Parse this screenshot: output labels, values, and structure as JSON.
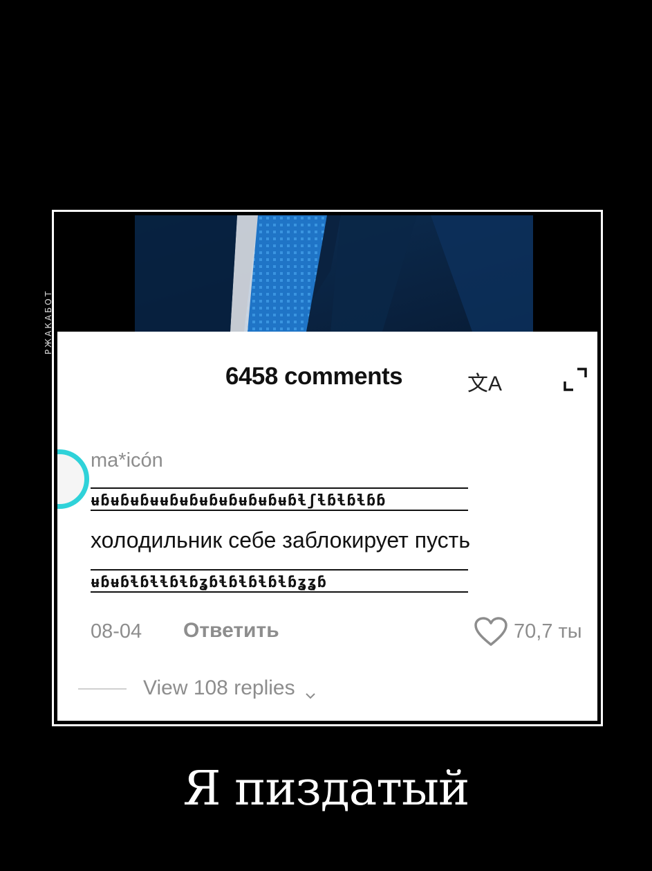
{
  "watermark": {
    "text": "РЖАКАБОТ"
  },
  "comments": {
    "count_label": "6458 comments",
    "translate_icon_label": "文A",
    "comment": {
      "username": "ma*icón",
      "deco_top": "ʉɓʉɓʉɓʉʉɓʉɓʉɓʉɓʉɓʉɓʉɓɬʃɬɓɬɓɬɓɓ",
      "text": "холодильник себе заблокирует пусть",
      "deco_bottom": "ʉɓʉɓɬɓɬɬɓɬɓʓɓɬɓɬɓɬɓɬɓʓʓɓ",
      "date": "08-04",
      "reply_label": "Ответить",
      "likes": "70,7 ты"
    },
    "view_replies_label": "View 108 replies"
  },
  "caption": {
    "text": "Я пиздатый"
  },
  "colors": {
    "background": "#000000",
    "panel": "#ffffff",
    "avatar_ring": "#2fd2d9",
    "muted_text": "#8d8d8d",
    "tie_blue": "#1f74c6",
    "suit": "#0b2a4b"
  }
}
